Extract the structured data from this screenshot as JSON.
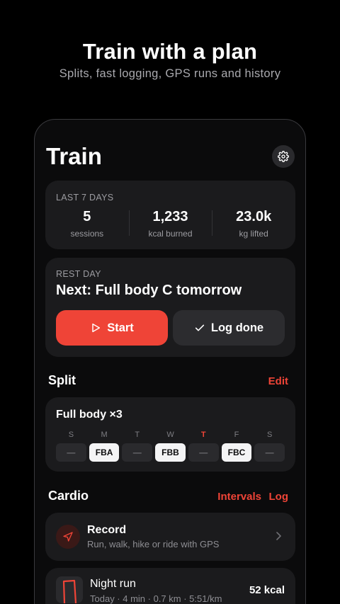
{
  "hero": {
    "title": "Train with a plan",
    "subtitle": "Splits, fast logging, GPS runs and history"
  },
  "screen": {
    "title": "Train",
    "settings_icon": "gear-icon"
  },
  "stats": {
    "kicker": "LAST 7 DAYS",
    "items": [
      {
        "value": "5",
        "label": "sessions"
      },
      {
        "value": "1,233",
        "label": "kcal burned"
      },
      {
        "value": "23.0k",
        "label": "kg lifted"
      }
    ]
  },
  "next": {
    "kicker": "REST DAY",
    "title": "Next: Full body C tomorrow",
    "start_label": "Start",
    "start_icon": "play-icon",
    "log_label": "Log done",
    "log_icon": "check-icon"
  },
  "split": {
    "section_title": "Split",
    "edit_label": "Edit",
    "name": "Full body ×3",
    "days": [
      {
        "letter": "S",
        "chip": "—",
        "active": false,
        "today": false
      },
      {
        "letter": "M",
        "chip": "FBA",
        "active": true,
        "today": false
      },
      {
        "letter": "T",
        "chip": "—",
        "active": false,
        "today": false
      },
      {
        "letter": "W",
        "chip": "FBB",
        "active": true,
        "today": false
      },
      {
        "letter": "T",
        "chip": "—",
        "active": false,
        "today": true
      },
      {
        "letter": "F",
        "chip": "FBC",
        "active": true,
        "today": false
      },
      {
        "letter": "S",
        "chip": "—",
        "active": false,
        "today": false
      }
    ]
  },
  "cardio": {
    "section_title": "Cardio",
    "intervals_label": "Intervals",
    "log_label": "Log",
    "record": {
      "title": "Record",
      "subtitle": "Run, walk, hike or ride with GPS",
      "icon": "navigation-arrow-icon"
    },
    "recent": {
      "title": "Night run",
      "subtitle": "Today · 4 min · 0.7 km · 5:51/km",
      "kcal": "52 kcal"
    }
  },
  "colors": {
    "accent": "#ef4437",
    "card": "#1b1b1d",
    "background": "#000000"
  }
}
